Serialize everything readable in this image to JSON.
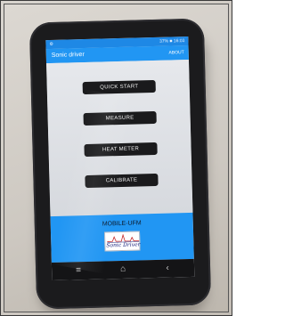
{
  "status_bar": {
    "left_icon": "settings-icon",
    "right_text": "37% ■ 16:03"
  },
  "app_bar": {
    "title": "Sonic driver",
    "about_label": "ABOUT"
  },
  "buttons": [
    {
      "label": "QUICK START"
    },
    {
      "label": "MEASURE"
    },
    {
      "label": "HEAT METER"
    },
    {
      "label": "CALIBRATE"
    }
  ],
  "footer": {
    "heading": "MOBILE-UFM",
    "logo_text": "Sonic Driver"
  },
  "nav_bar": {
    "menu_icon": "menu-icon",
    "home_icon": "home-icon",
    "back_icon": "back-icon"
  },
  "colors": {
    "accent": "#2196f3",
    "button": "#1a1a1c",
    "phone_body": "#1b1b1d"
  }
}
